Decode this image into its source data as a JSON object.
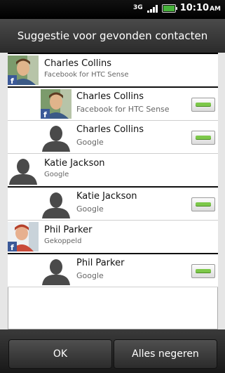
{
  "status": {
    "network": "3G",
    "time": "10:10",
    "ampm": "AM"
  },
  "title": "Suggestie voor gevonden contacten",
  "rows": [
    {
      "type": "parent",
      "name": "Charles Collins",
      "source": "Facebook for HTC Sense",
      "photo": "photo",
      "fb": true
    },
    {
      "type": "child",
      "name": "Charles Collins",
      "source": "Facebook for HTC Sense",
      "photo": "photo",
      "fb": true
    },
    {
      "type": "child",
      "name": "Charles Collins",
      "source": "Google",
      "photo": "silhouette",
      "fb": false
    },
    {
      "type": "parent",
      "name": "Katie Jackson",
      "source": "Google",
      "photo": "silhouette",
      "fb": false
    },
    {
      "type": "child",
      "name": "Katie Jackson",
      "source": "Google",
      "photo": "silhouette",
      "fb": false
    },
    {
      "type": "parent",
      "name": "Phil Parker",
      "source": "Gekoppeld",
      "photo": "photo",
      "fb": true
    },
    {
      "type": "child",
      "name": "Phil Parker",
      "source": "Google",
      "photo": "silhouette",
      "fb": false
    }
  ],
  "buttons": {
    "ok": "OK",
    "ignore": "Alles negeren"
  }
}
